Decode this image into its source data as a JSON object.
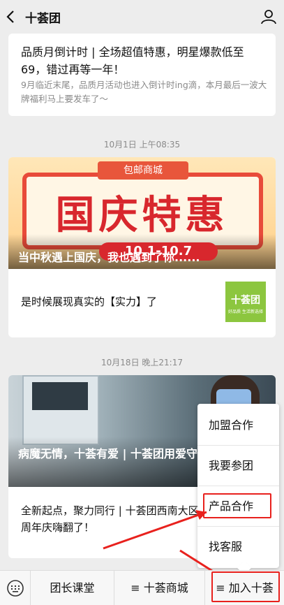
{
  "header": {
    "title": "十荟团"
  },
  "articles": {
    "a1": {
      "title": "品质月倒计时 | 全场超值特惠，明星爆款低至69，错过再等一年！",
      "desc": "9月临近末尾，品质月活动也进入倒计时ing滴，本月最后一波大牌福利马上要发车了～"
    },
    "time1": "10月1日 上午08:35",
    "a2": {
      "banner_tag": "包邮商城",
      "banner_big": "国庆特惠",
      "banner_num": "10.1-10.7",
      "caption": "当中秋遇上国庆，我也遇到了你......",
      "sub": "是时候展现真实的【实力】了",
      "logo_name": "十荟团",
      "logo_slogan": "好品质 生活新选择"
    },
    "time2": "10月18日 晚上21:17",
    "a3": {
      "caption": "病魔无情，十荟有爱 | 十荟团用爱守望！",
      "sub": "全新起点，聚力同行 | 十荟团西南大区周年庆嗨翻了！"
    }
  },
  "popup": {
    "items": [
      "加盟合作",
      "我要参团",
      "产品合作",
      "找客服"
    ]
  },
  "bottom": {
    "tab1": "团长课堂",
    "tab2": "≡ 十荟商城",
    "tab3": "≡ 加入十荟"
  },
  "colors": {
    "highlight": "#e8211d",
    "logo_green": "#8cc63f",
    "accent_red": "#d8272d"
  }
}
